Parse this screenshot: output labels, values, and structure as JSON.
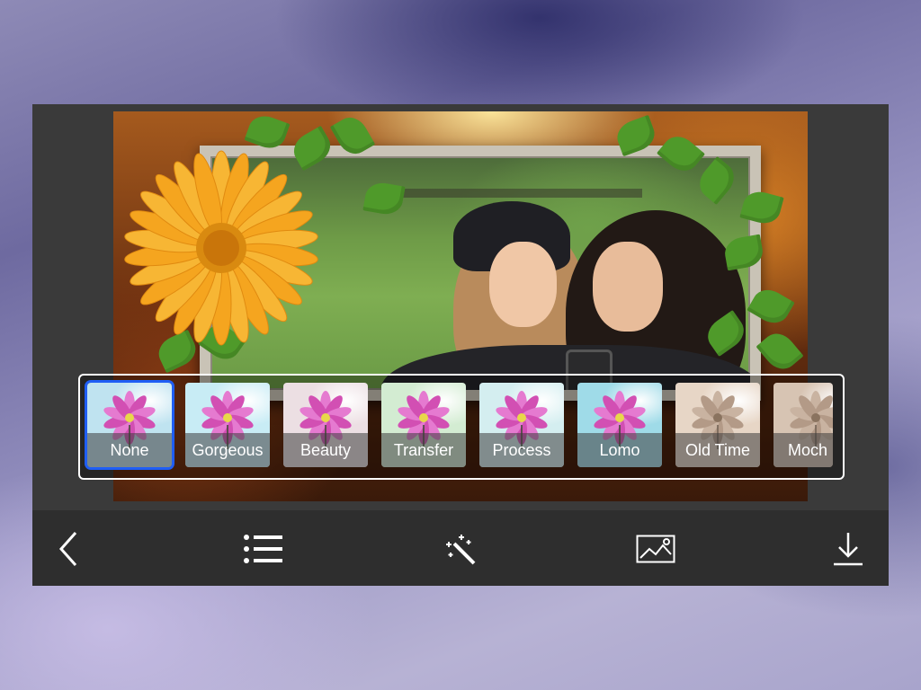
{
  "filters": [
    {
      "label": "None",
      "selected": true,
      "tint": "#bfe3f0"
    },
    {
      "label": "Gorgeous",
      "selected": false,
      "tint": "#c8ecf5"
    },
    {
      "label": "Beauty",
      "selected": false,
      "tint": "#ecdfe3"
    },
    {
      "label": "Transfer",
      "selected": false,
      "tint": "#d3ecd2"
    },
    {
      "label": "Process",
      "selected": false,
      "tint": "#d4eef0"
    },
    {
      "label": "Lomo",
      "selected": false,
      "tint": "#9fdbe8"
    },
    {
      "label": "Old Time",
      "selected": false,
      "tint": "#e7d6c6"
    },
    {
      "label": "Moch",
      "selected": false,
      "tint": "#d7c4b3"
    }
  ],
  "toolbar": {
    "items": [
      "back-icon",
      "list-icon",
      "magic-wand-icon",
      "image-icon",
      "download-icon"
    ]
  },
  "colors": {
    "device": "#3a3a3a",
    "toolbar": "#2e2e2e",
    "selection": "#1f5ef5",
    "filter_label_text": "#ffffff"
  }
}
